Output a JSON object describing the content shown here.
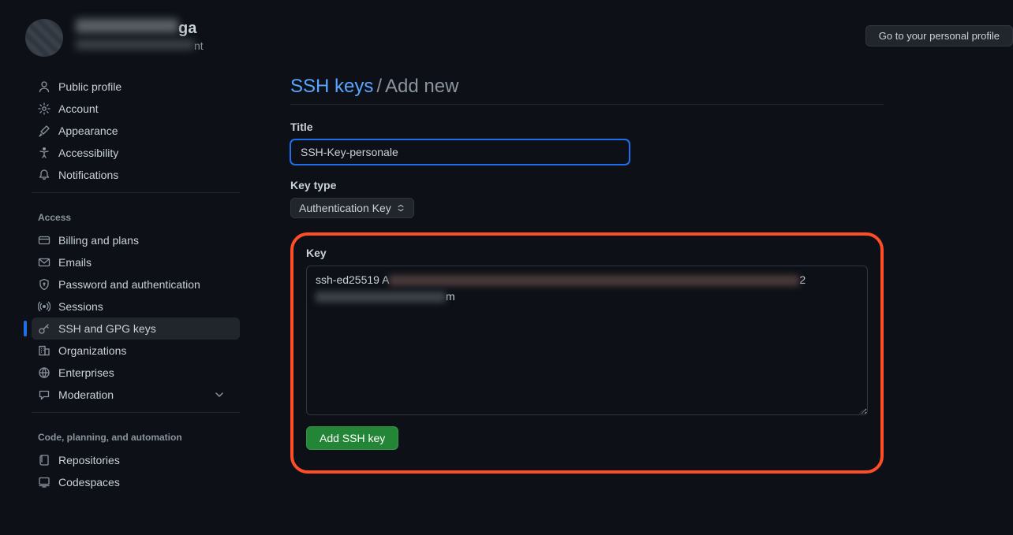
{
  "header": {
    "user_name_suffix": "ga",
    "user_sub_suffix": "nt",
    "personal_profile_btn": "Go to your personal profile"
  },
  "sidebar": {
    "groups": [
      {
        "items": [
          {
            "id": "public-profile",
            "icon": "person",
            "label": "Public profile"
          },
          {
            "id": "account",
            "icon": "gear",
            "label": "Account"
          },
          {
            "id": "appearance",
            "icon": "paintbrush",
            "label": "Appearance"
          },
          {
            "id": "accessibility",
            "icon": "accessibility",
            "label": "Accessibility"
          },
          {
            "id": "notifications",
            "icon": "bell",
            "label": "Notifications"
          }
        ]
      },
      {
        "header": "Access",
        "items": [
          {
            "id": "billing",
            "icon": "credit-card",
            "label": "Billing and plans"
          },
          {
            "id": "emails",
            "icon": "mail",
            "label": "Emails"
          },
          {
            "id": "password",
            "icon": "shield-lock",
            "label": "Password and authentication"
          },
          {
            "id": "sessions",
            "icon": "broadcast",
            "label": "Sessions"
          },
          {
            "id": "ssh",
            "icon": "key",
            "label": "SSH and GPG keys",
            "active": true
          },
          {
            "id": "organizations",
            "icon": "organization",
            "label": "Organizations"
          },
          {
            "id": "enterprises",
            "icon": "globe",
            "label": "Enterprises"
          },
          {
            "id": "moderation",
            "icon": "comment",
            "label": "Moderation",
            "chevron": true
          }
        ]
      },
      {
        "header": "Code, planning, and automation",
        "items": [
          {
            "id": "repositories",
            "icon": "repo",
            "label": "Repositories"
          },
          {
            "id": "codespaces",
            "icon": "codespaces",
            "label": "Codespaces"
          }
        ]
      }
    ]
  },
  "main": {
    "breadcrumb_link": "SSH keys",
    "breadcrumb_current": "Add new",
    "title_label": "Title",
    "title_value": "SSH-Key-personale",
    "keytype_label": "Key type",
    "keytype_value": "Authentication Key",
    "key_label": "Key",
    "key_prefix": "ssh-ed25519 A",
    "key_mid_char": "2",
    "key_suffix": "m",
    "submit_label": "Add SSH key"
  }
}
